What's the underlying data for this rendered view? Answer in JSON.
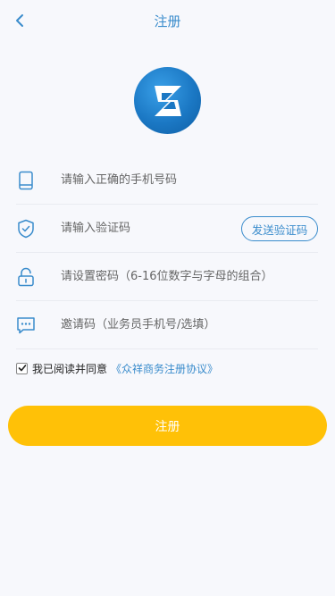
{
  "header": {
    "title": "注册"
  },
  "form": {
    "phone_placeholder": "请输入正确的手机号码",
    "code_placeholder": "请输入验证码",
    "send_code_label": "发送验证码",
    "password_placeholder": "请设置密码（6-16位数字与字母的组合）",
    "invite_placeholder": "邀请码（业务员手机号/选填）"
  },
  "agreement": {
    "checked": true,
    "prefix": "我已阅读并同意",
    "link": "《众祥商务注册协议》"
  },
  "submit_label": "注册",
  "icons": {
    "back": "chevron-left-icon",
    "logo": "app-logo",
    "phone": "phone-icon",
    "shield": "shield-check-icon",
    "lock": "lock-icon",
    "chat": "chat-icon"
  },
  "colors": {
    "accent": "#3a8ccc",
    "button": "#ffc107",
    "background": "#f7f8fc"
  }
}
